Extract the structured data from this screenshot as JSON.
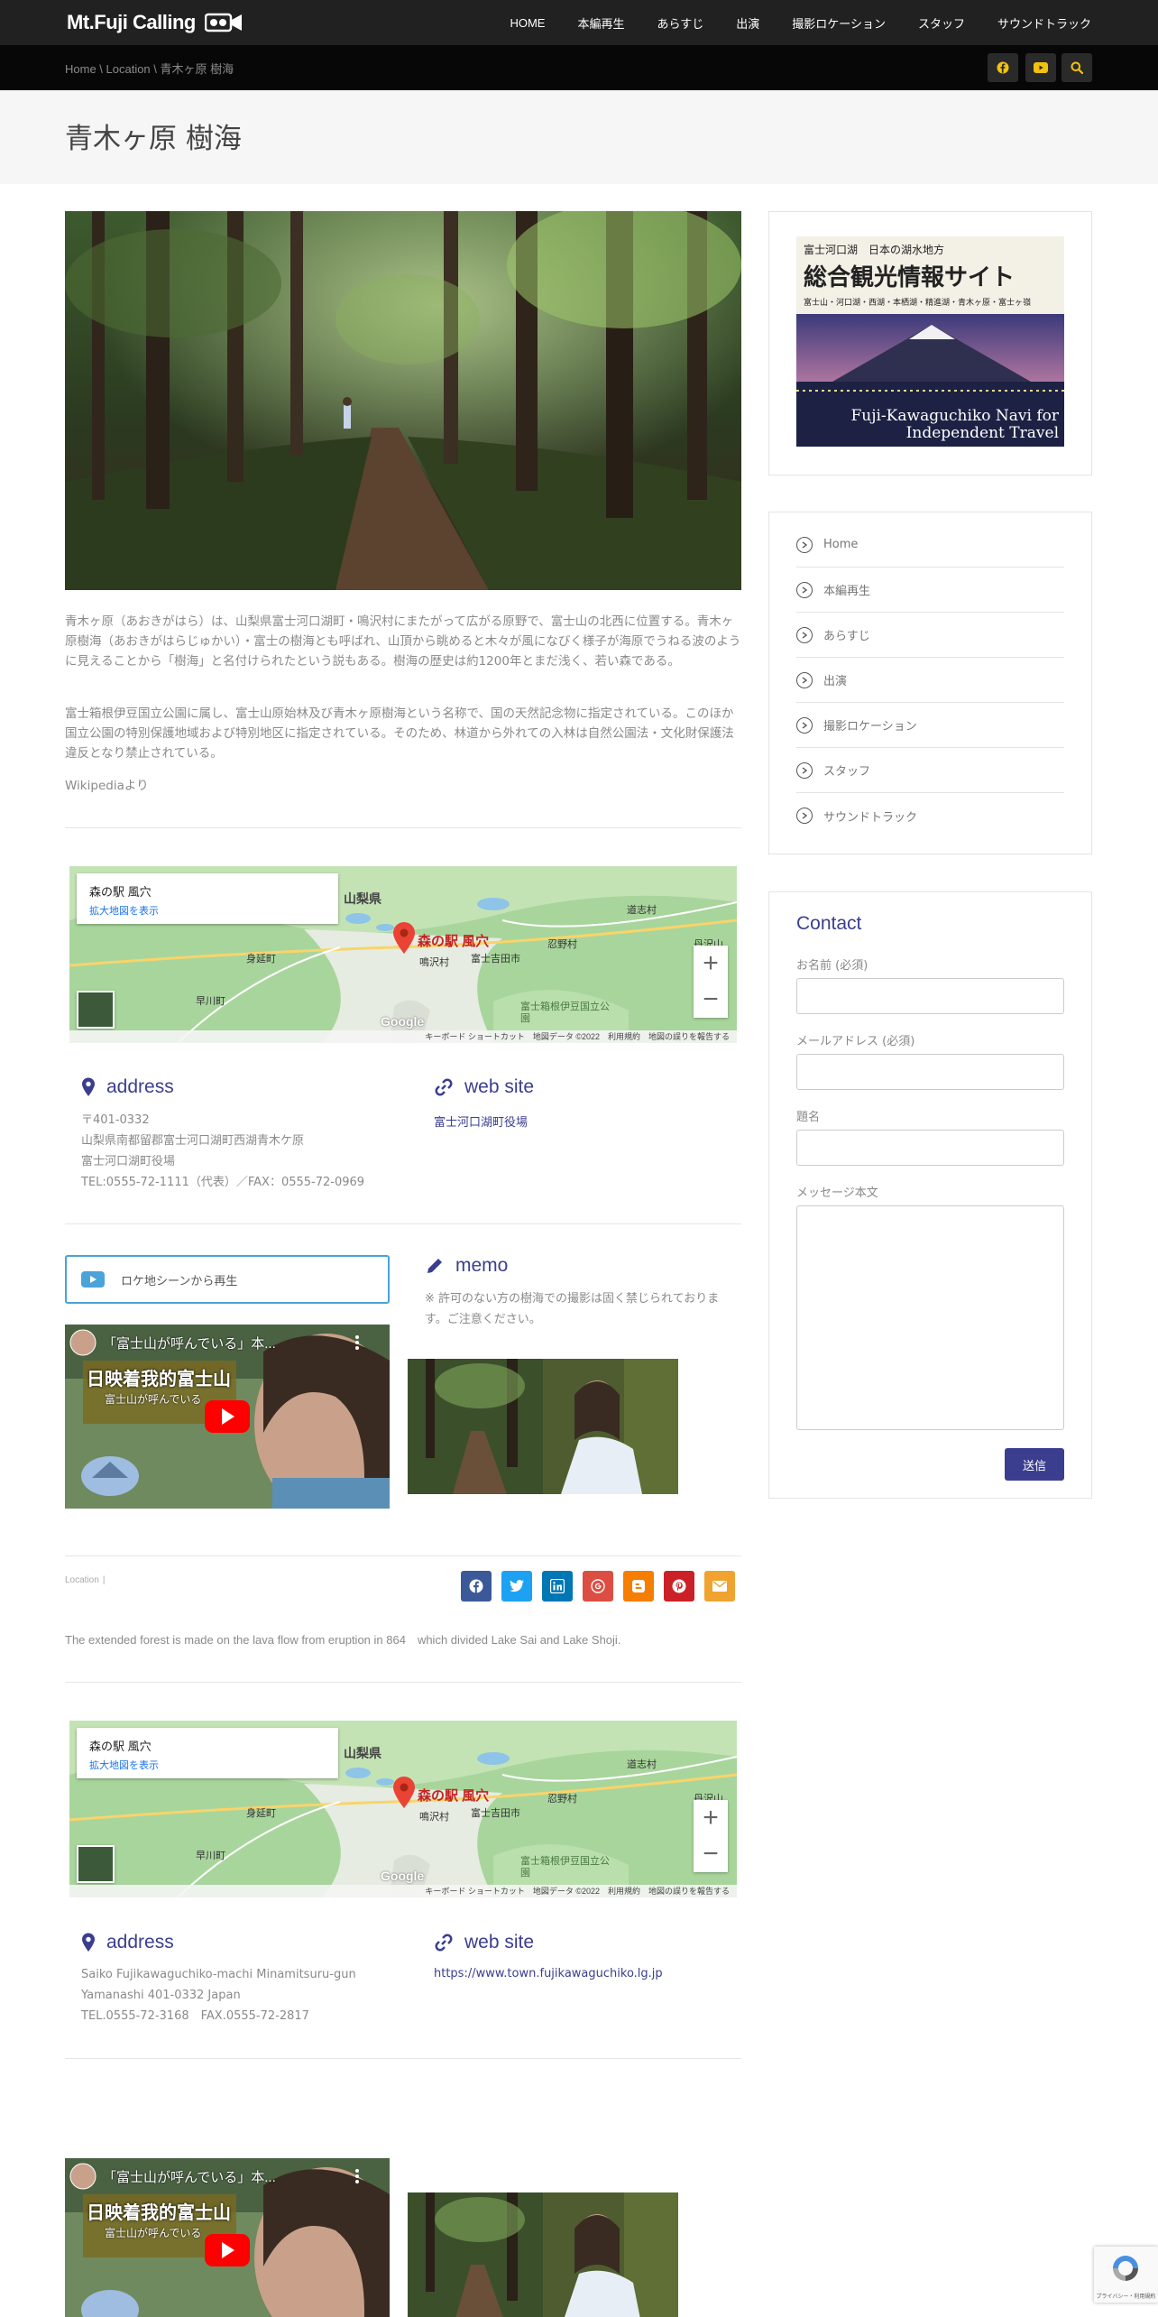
{
  "header": {
    "logo_text": "Mt.Fuji Calling",
    "nav": [
      "HOME",
      "本編再生",
      "あらすじ",
      "出演",
      "撮影ロケーション",
      "スタッフ",
      "サウンドトラック"
    ]
  },
  "breadcrumb": "Home \\ Location \\ 青木ヶ原 樹海",
  "page_title": "青木ヶ原 樹海",
  "description": {
    "p1": "青木ヶ原（あおきがはら）は、山梨県富士河口湖町・鳴沢村にまたがって広がる原野で、富士山の北西に位置する。青木ヶ原樹海（あおきがはらじゅかい）・富士の樹海とも呼ばれ、山頂から眺めると木々が風になびく様子が海原でうねる波のように見えることから「樹海」と名付けられたという説もある。樹海の歴史は約1200年とまだ浅く、若い森である。",
    "p2": "富士箱根伊豆国立公園に属し、富士山原始林及び青木ヶ原樹海という名称で、国の天然記念物に指定されている。このほか国立公園の特別保護地域および特別地区に指定されている。そのため、林道から外れての入林は自然公園法・文化財保護法違反となり禁止されている。",
    "source": "Wikipediaより"
  },
  "map": {
    "place_name": "森の駅 風穴",
    "enlarge_link": "拡大地図を表示",
    "footer": "キーボード ショートカット　地図データ ©2022　利用規約　地図の誤りを報告する",
    "labels": [
      "山梨県",
      "富士吉田市",
      "鳴沢村",
      "忍野村",
      "道志村",
      "丹沢山",
      "早川町",
      "身延町",
      "富士箱根伊豆国立公園",
      "森の駅 風穴",
      "Google"
    ]
  },
  "section1": {
    "address_heading": "address",
    "address_lines": [
      "〒401-0332",
      "山梨県南都留郡富士河口湖町西湖青木ケ原",
      "富士河口湖町役場",
      "TEL:0555-72-1111（代表）／FAX：0555-72-0969"
    ],
    "website_heading": "web site",
    "website_link": "富士河口湖町役場"
  },
  "play_button": "ロケ地シーンから再生",
  "memo": {
    "heading": "memo",
    "text": "※ 許可のない方の樹海での撮影は固く禁じられております。ご注意ください。"
  },
  "video": {
    "title": "「富士山が呼んでいる」本...",
    "overlay_title": "日映着我的富士山",
    "overlay_sub": "富士山が呼んでいる"
  },
  "meta": {
    "category": "Location",
    "separator": "|"
  },
  "share_icons": [
    "facebook-icon",
    "twitter-icon",
    "linkedin-icon",
    "google-icon",
    "blogger-icon",
    "pinterest-icon",
    "email-icon"
  ],
  "share_colors": [
    "#3b5998",
    "#1da1f2",
    "#0077b5",
    "#dc4e41",
    "#f57d00",
    "#cb2027",
    "#f0a32f"
  ],
  "english_text": "The extended forest is made on the lava flow from eruption in 864　which divided Lake Sai and Lake Shoji.",
  "section2": {
    "address_heading": "address",
    "address_lines": [
      "Saiko Fujikawaguchiko-machi Minamitsuru-gun",
      "Yamanashi 401-0332 Japan",
      "TEL.0555-72-3168　FAX.0555-72-2817"
    ],
    "website_heading": "web site",
    "website_link": "https://www.town.fujikawaguchiko.lg.jp"
  },
  "sidebar": {
    "banner": {
      "line1": "富士河口湖　日本の湖水地方",
      "line2": "総合観光情報サイト",
      "line3": "富士山・河口湖・西湖・本栖湖・精進湖・青木ヶ原・富士ヶ嶺",
      "caption1": "Fuji-Kawaguchiko Navi for",
      "caption2": "Independent Travel"
    },
    "menu": [
      "Home",
      "本編再生",
      "あらすじ",
      "出演",
      "撮影ロケーション",
      "スタッフ",
      "サウンドトラック"
    ],
    "contact": {
      "heading": "Contact",
      "name_label": "お名前 (必須)",
      "email_label": "メールアドレス (必須)",
      "subject_label": "題名",
      "message_label": "メッセージ本文",
      "submit": "送信"
    }
  },
  "recaptcha": "プライバシー・利用規約",
  "colors": {
    "accent": "#3b3e8f",
    "topbar": "#212121",
    "icon_yellow": "#f3c20f"
  }
}
